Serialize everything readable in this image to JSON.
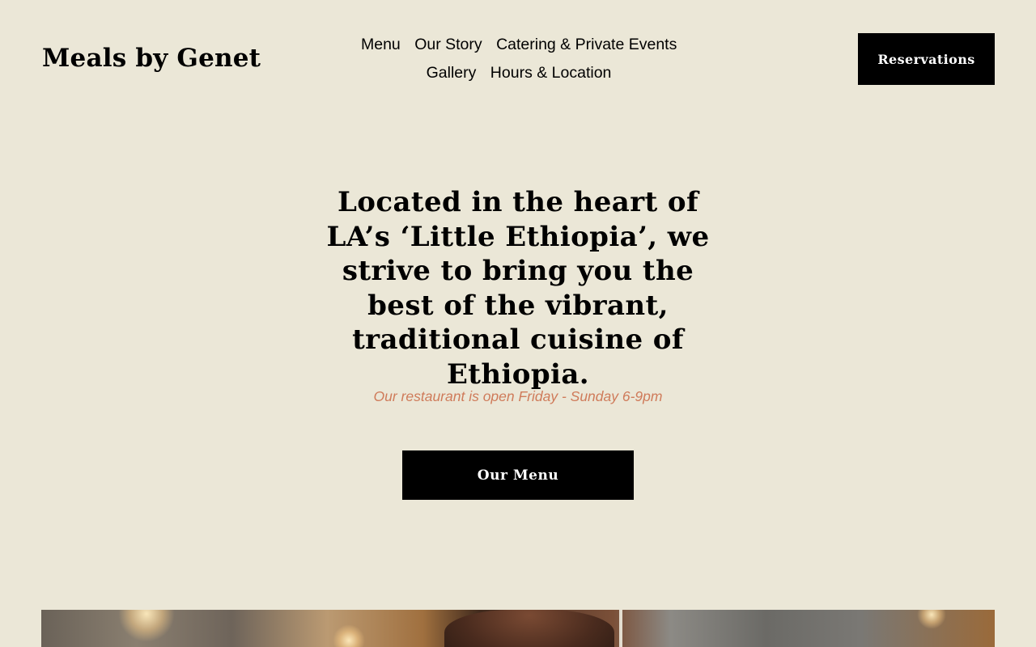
{
  "site": {
    "brand": "Meals by Genet"
  },
  "nav": {
    "row1": [
      {
        "label": "Menu"
      },
      {
        "label": "Our Story"
      },
      {
        "label": "Catering & Private Events"
      }
    ],
    "row2": [
      {
        "label": "Gallery"
      },
      {
        "label": "Hours & Location"
      }
    ]
  },
  "header": {
    "cta_label": "Reservations"
  },
  "hero": {
    "heading": "Located in the heart of LA’s ‘Little Ethiopia’, we strive to bring you the best of the vibrant, traditional cuisine of Ethiopia.",
    "hours_note": "Our restaurant is open Friday - Sunday 6-9pm",
    "button_label": "Our Menu"
  },
  "colors": {
    "background": "#ebe7d7",
    "text": "#000000",
    "accent": "#cf7b5a",
    "button_bg": "#000000",
    "button_text": "#ffffff"
  }
}
